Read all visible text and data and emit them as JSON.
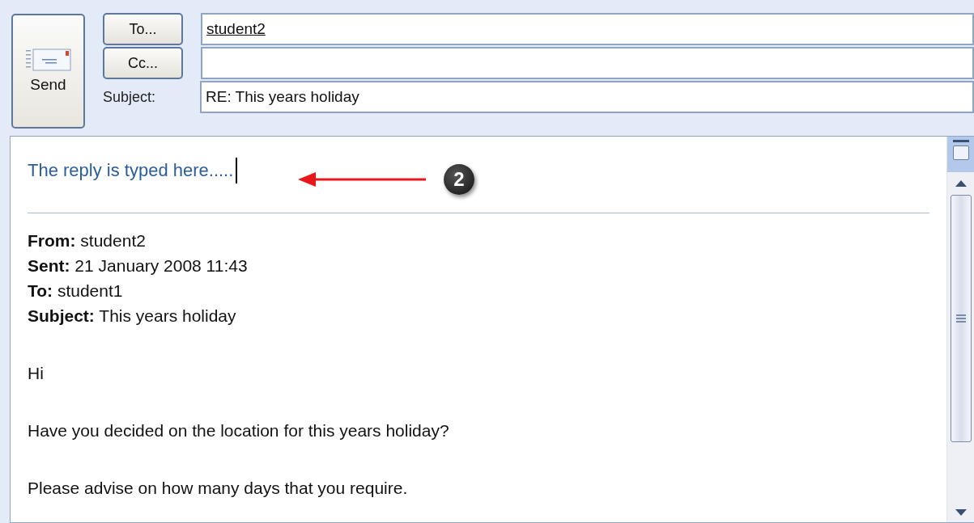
{
  "send_button": {
    "label": "Send"
  },
  "recipients": [
    {
      "button": "To...",
      "value": "student2"
    },
    {
      "button": "Cc..."
    }
  ],
  "subject": {
    "label": "Subject:",
    "value": "RE: This years holiday"
  },
  "body": {
    "reply": "The reply is typed here.....",
    "quoted_header": [
      "**From:** student2",
      "**Sent:** 21 January 2008 11:43",
      "**To:** student1",
      "**Subject:** This years holiday"
    ],
    "paragraphs": [
      "Hi",
      "Have you decided on the location for this years holiday?",
      "Please advise on how many days that you require."
    ]
  },
  "annotation": {
    "number": "2"
  }
}
